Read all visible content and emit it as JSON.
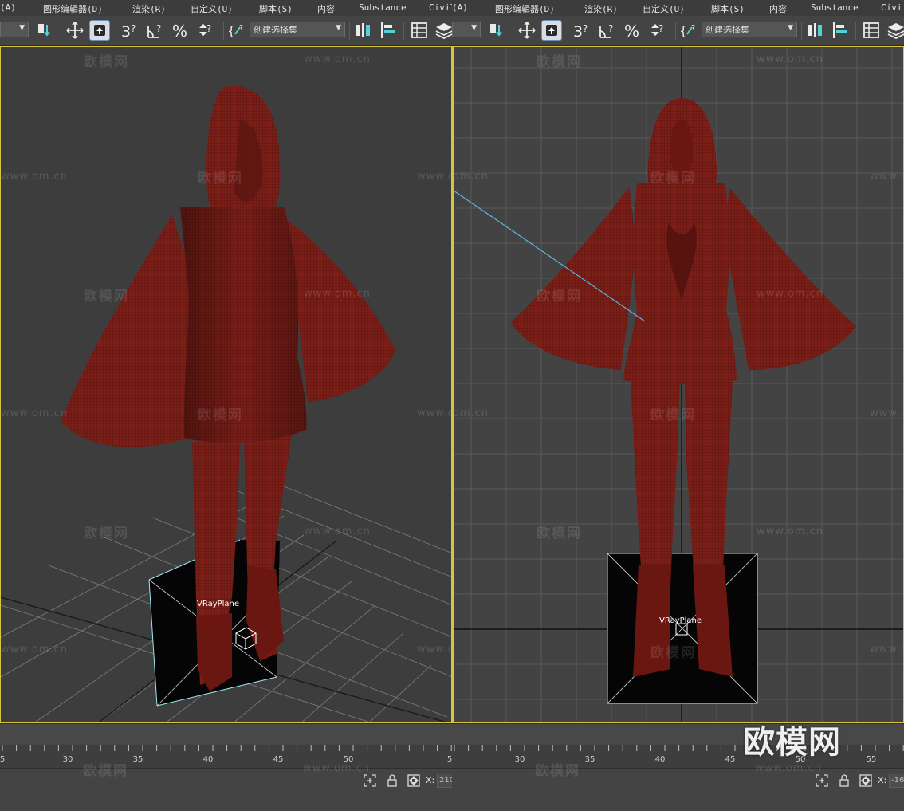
{
  "menu": {
    "left": [
      "(A)",
      "图形编辑器(D)",
      "渲染(R)",
      "自定义(U)",
      "脚本(S)",
      "内容",
      "Substance",
      "Civil"
    ],
    "right": [
      "(A)",
      "图形编辑器(D)",
      "渲染(R)",
      "自定义(U)",
      "脚本(S)",
      "内容",
      "Substance",
      "Civi"
    ]
  },
  "toolbar": {
    "selection_set_placeholder": "创建选择集",
    "icons": [
      "move-icon",
      "select-object-icon",
      "snap-3d-icon",
      "angle-snap-icon",
      "percent-snap-icon",
      "spinner-snap-icon",
      "named-selection-icon",
      "mirror-icon",
      "align-icon",
      "layer-explorer-icon",
      "layers-icon"
    ]
  },
  "viewports": {
    "left": {
      "object_label": "VRayPlane",
      "active": true
    },
    "right": {
      "object_label": "VRayPlane",
      "active": true
    }
  },
  "watermarks": {
    "brand": "欧模网",
    "url": "www.om.cn",
    "corner": "欧模网"
  },
  "timeline": {
    "left_ticks": [
      "5",
      "30",
      "35",
      "40",
      "45",
      "50",
      "5"
    ],
    "right_ticks": [
      "30",
      "35",
      "40",
      "45",
      "50",
      "55"
    ]
  },
  "statusbar": {
    "x_label": "X:",
    "left_x_value": "210",
    "right_x_value": "-16"
  },
  "colors": {
    "model_color": "#7a1e18",
    "wire_color": "#4a0e0a",
    "viewport_border": "#d6c63a",
    "selection_cyan": "#9ee7f2"
  }
}
